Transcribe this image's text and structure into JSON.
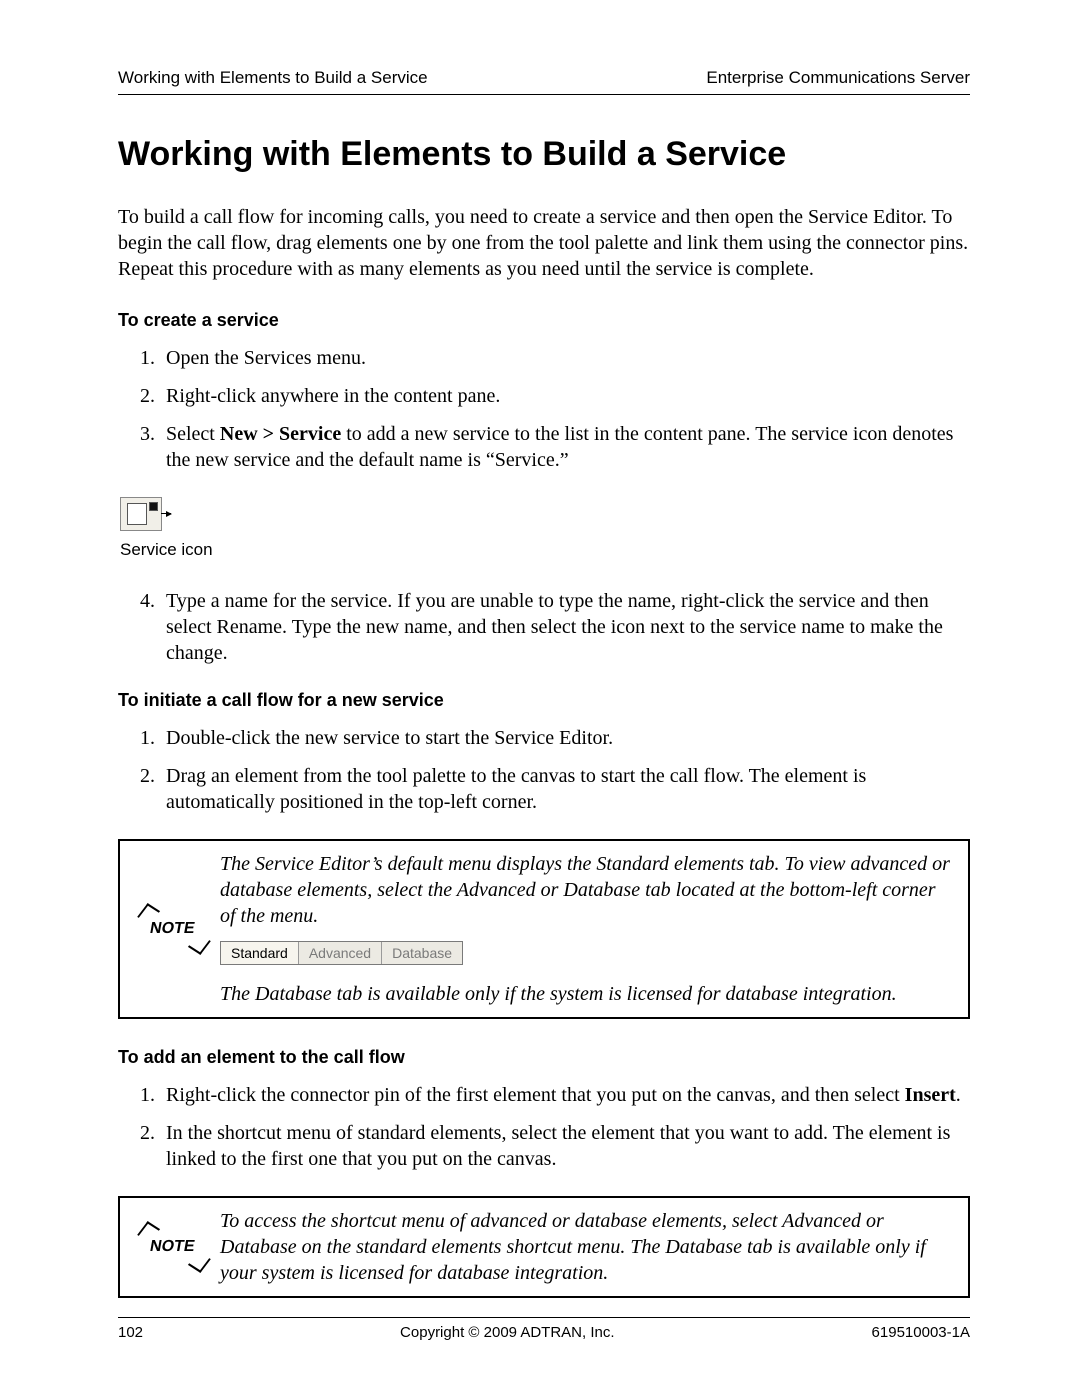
{
  "header": {
    "left": "Working with Elements to Build a Service",
    "right": "Enterprise Communications Server"
  },
  "title": "Working with Elements to Build a Service",
  "intro": "To build a call flow for incoming calls, you need to create a service and then open the Service Editor. To begin the call flow, drag elements one by one from the tool palette and link them using the connector pins. Repeat this procedure with as many elements as you need until the service is complete.",
  "sections": {
    "create": {
      "heading": "To create a service",
      "steps": [
        "Open the Services menu.",
        "Right-click anywhere in the content pane.",
        "to add a new service to the list in the content pane. The service icon denotes the new service and the default name is “Service.”",
        "Type a name for the service. If you are unable to type the name, right-click the service and then select Rename. Type the new name, and then select the icon next to the service name to make the change."
      ],
      "step3_prefix": "Select ",
      "step3_bold": "New > Service",
      "step3_space": " ",
      "icon_caption": "Service icon"
    },
    "initiate": {
      "heading": "To initiate a call flow for a new service",
      "steps": [
        "Double-click the new service to start the Service Editor.",
        "Drag an element from the tool palette to the canvas to start the call flow. The element is automatically positioned in the top-left corner."
      ]
    },
    "add": {
      "heading": "To add an element to the call flow",
      "steps": [
        "Right-click the connector pin of the first element that you put on the canvas, and then select ",
        "In the shortcut menu of standard elements, select the element that you want to add. The element is linked to the first one that you put on the canvas."
      ],
      "step1_bold": "Insert",
      "step1_period": "."
    }
  },
  "notes": {
    "label": "NOTE",
    "one": {
      "p1": "The Service Editor’s default menu displays the Standard elements tab. To view advanced or database elements, select the Advanced or Database tab located at the bottom-left corner of the menu.",
      "p2": "The Database tab is available only if the system is licensed for database integration."
    },
    "two": "To access the shortcut menu of advanced or database elements, select Advanced or Database on the standard elements shortcut menu. The Database tab is available only if your system is licensed for database integration."
  },
  "tabs": {
    "standard": "Standard",
    "advanced": "Advanced",
    "database": "Database"
  },
  "footer": {
    "page": "102",
    "center": "Copyright © 2009 ADTRAN, Inc.",
    "right": "619510003-1A"
  }
}
